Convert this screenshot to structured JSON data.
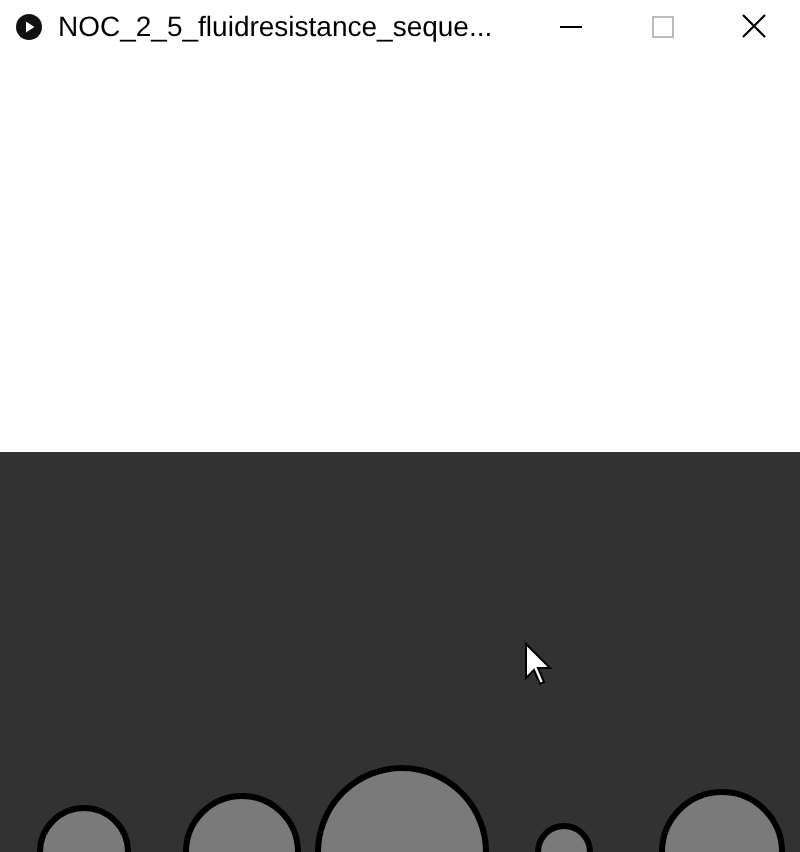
{
  "window": {
    "title": "NOC_2_5_fluidresistance_seque..."
  }
}
